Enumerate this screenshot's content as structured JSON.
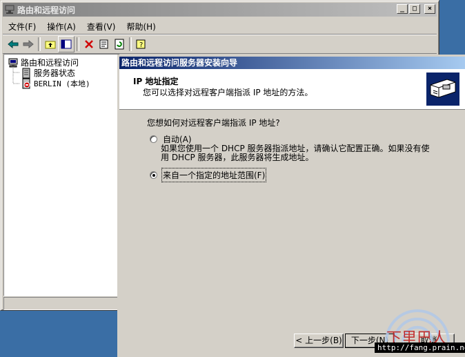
{
  "main_window": {
    "title": "路由和远程访问",
    "caption_buttons": {
      "minimize": "_",
      "maximize": "□",
      "close": "×"
    },
    "menu": [
      "文件(F)",
      "操作(A)",
      "查看(V)",
      "帮助(H)"
    ],
    "toolbar_icons": [
      "back-arrow-icon",
      "forward-arrow-icon",
      "up-folder-icon",
      "show-tree-icon",
      "delete-icon",
      "properties-icon",
      "refresh-icon",
      "help-icon"
    ],
    "tree": {
      "root": "路由和远程访问",
      "items": [
        "服务器状态",
        "BERLIN (本地)"
      ]
    }
  },
  "wizard": {
    "title": "路由和远程访问服务器安装向导",
    "header_title": "IP 地址指定",
    "header_subtitle": "您可以选择对远程客户端指派 IP 地址的方法。",
    "question": "您想如何对远程客户端指派 IP 地址?",
    "options": [
      {
        "label": "自动(A)",
        "selected": false
      },
      {
        "label": "来自一个指定的地址范围(F)",
        "selected": true
      }
    ],
    "auto_description_line1": "如果您使用一个 DHCP 服务器指派地址，请确认它配置正确。如果没有使",
    "auto_description_line2": "用 DHCP 服务器，此服务器将生成地址。",
    "buttons": {
      "back": "< 上一步(B)",
      "next": "下一步(N)",
      "cancel": "取消"
    }
  },
  "watermark": {
    "url": "http://fang.prain.net",
    "text": "下里巴人"
  }
}
